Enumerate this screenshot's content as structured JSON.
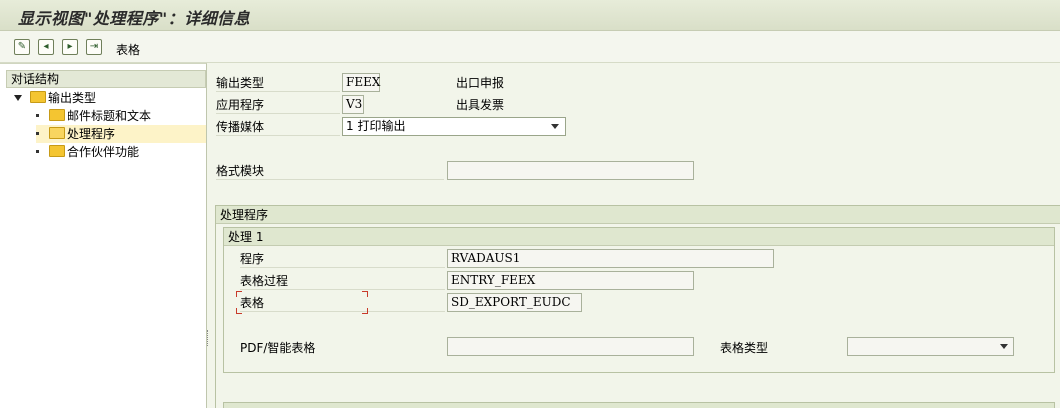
{
  "window": {
    "title": "显示视图\"处理程序\"：详细信息"
  },
  "toolbar": {
    "icons": [
      "change-display-icon",
      "previous-entry-icon",
      "next-entry-icon",
      "other-entry-icon"
    ],
    "form_label": "表格"
  },
  "dialog_structure": {
    "header": "对话结构",
    "items": [
      {
        "label": "输出类型",
        "level": 0,
        "expanded": true
      },
      {
        "label": "邮件标题和文本",
        "level": 1
      },
      {
        "label": "处理程序",
        "level": 1,
        "selected": true
      },
      {
        "label": "合作伙伴功能",
        "level": 1
      }
    ]
  },
  "header_fields": {
    "output_type": {
      "label": "输出类型",
      "value": "FEEX",
      "description": "出口申报"
    },
    "application": {
      "label": "应用程序",
      "value": "V3",
      "description": "出具发票"
    },
    "medium": {
      "label": "传播媒体",
      "value": "1 打印输出"
    },
    "form_module": {
      "label": "格式模块",
      "value": ""
    }
  },
  "processing": {
    "group_title": "处理程序",
    "subgroup_title": "处理 1",
    "program": {
      "label": "程序",
      "value": "RVADAUS1"
    },
    "form_routine": {
      "label": "表格过程",
      "value": "ENTRY_FEEX"
    },
    "form": {
      "label": "表格",
      "value": "SD_EXPORT_EUDC"
    },
    "pdf_smartform": {
      "label": "PDF/智能表格",
      "value": ""
    },
    "form_type": {
      "label": "表格类型",
      "value": ""
    }
  },
  "colors": {
    "selection": "#fdf3c8",
    "focus_mark": "#c83a2a",
    "group_header": "#dfe7cf"
  }
}
